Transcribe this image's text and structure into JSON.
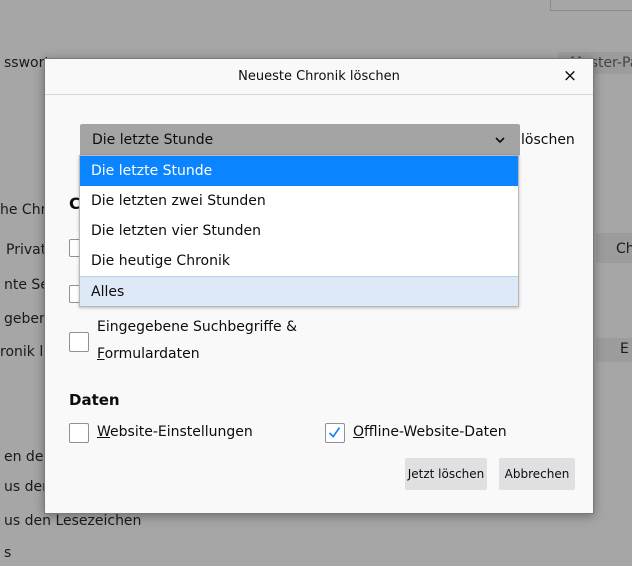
{
  "background": {
    "fragments": [
      "sswort",
      "Master-Pa",
      "he Chro",
      "Privat",
      "nte Sei",
      "gebene",
      "ronik l",
      "en der",
      "us der",
      "us den Lesezeichen",
      "s",
      "Ch",
      "E"
    ]
  },
  "dialog": {
    "title": "Neueste Chronik löschen",
    "close_glyph": "×",
    "time_range": {
      "selected": "Die letzte Stunde"
    },
    "delete_suffix": "löschen",
    "partial_heading": "C",
    "history_items": [
      {
        "label_pre": "",
        "label_access": "",
        "label_post": "",
        "checked": false
      },
      {
        "label_pre": "",
        "label_access": "",
        "label_post": "",
        "checked": false
      },
      {
        "line1": "Eingegebene Suchbegriffe &",
        "line2_access": "F",
        "line2_post": "ormulardaten",
        "checked": false
      }
    ],
    "data_heading": "Daten",
    "data_items": [
      {
        "label_access": "W",
        "label_post": "ebsite-Einstellungen",
        "checked": false
      },
      {
        "label_access": "O",
        "label_post": "ffline-Website-Daten",
        "checked": true
      }
    ],
    "buttons": {
      "clear": "Jetzt löschen",
      "cancel": "Abbrechen"
    }
  },
  "dropdown": {
    "options": [
      "Die letzte Stunde",
      "Die letzten zwei Stunden",
      "Die letzten vier Stunden",
      "Die heutige Chronik",
      "Alles"
    ],
    "selected_index": 0,
    "hover_index": 4
  },
  "colors": {
    "accent": "#0a84ff",
    "hover": "#dde9f7",
    "check": "#0a84ff"
  }
}
